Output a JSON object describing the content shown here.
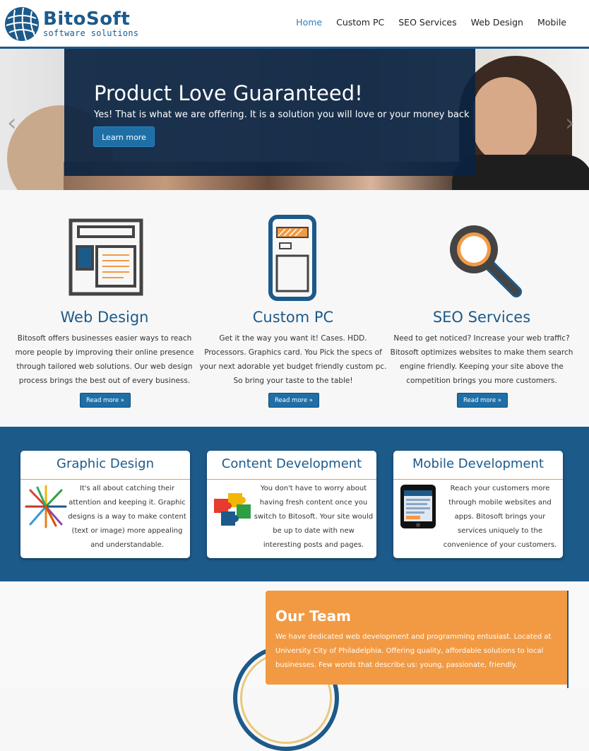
{
  "brand": {
    "name": "BitoSoft",
    "tagline": "software solutions"
  },
  "nav": [
    {
      "label": "Home",
      "active": true
    },
    {
      "label": "Custom PC"
    },
    {
      "label": "SEO Services"
    },
    {
      "label": "Web Design"
    },
    {
      "label": "Mobile"
    }
  ],
  "hero": {
    "title": "Product Love Guaranteed!",
    "subtitle": "Yes! That is what we are offering. It is a solution you will love or your money back",
    "button": "Learn more",
    "prev_icon": "chevron-left-icon",
    "next_icon": "chevron-right-icon"
  },
  "features": [
    {
      "icon": "web-layout-icon",
      "title": "Web Design",
      "text": "Bitosoft offers businesses easier ways to reach more people by improving their online presence through tailored web solutions. Our web design process brings the best out of every business.",
      "button": "Read more »"
    },
    {
      "icon": "pc-tower-icon",
      "title": "Custom PC",
      "text": "Get it the way you want it! Cases. HDD. Processors. Graphics card. You Pick the specs of your next adorable yet budget friendly custom pc. So bring your taste to the table!",
      "button": "Read more »"
    },
    {
      "icon": "magnifier-icon",
      "title": "SEO Services",
      "text": "Need to get noticed? Increase your web traffic? Bitosoft optimizes websites to make them search engine friendly. Keeping your site above the competition brings you more customers.",
      "button": "Read more »"
    }
  ],
  "cards": [
    {
      "icon": "colored-pencils-icon",
      "title": "Graphic Design",
      "text": "It's all about catching their attention and keeping it. Graphic designs is a way to make content (text or image) more appealing and understandable."
    },
    {
      "icon": "puzzle-pieces-icon",
      "title": "Content Development",
      "text": "You don't have to worry about having fresh content once you switch to Bitosoft. Your site would be up to date with new interesting posts and pages."
    },
    {
      "icon": "smartphone-icon",
      "title": "Mobile Development",
      "text": "Reach your customers more through mobile websites and apps. Bitosoft brings your services uniquely to the convenience of your customers."
    }
  ],
  "team": {
    "title": "Our Team",
    "text": "We have dedicated web development and programming entusiast. Located at University City of Philadelphia. Offering quality, affordable solutions to local businesses. Few words that describe us: young, passionate, friendly."
  },
  "colors": {
    "primary": "#1c5a8a",
    "accent": "#f29a43",
    "link_active": "#2a7fb8"
  }
}
